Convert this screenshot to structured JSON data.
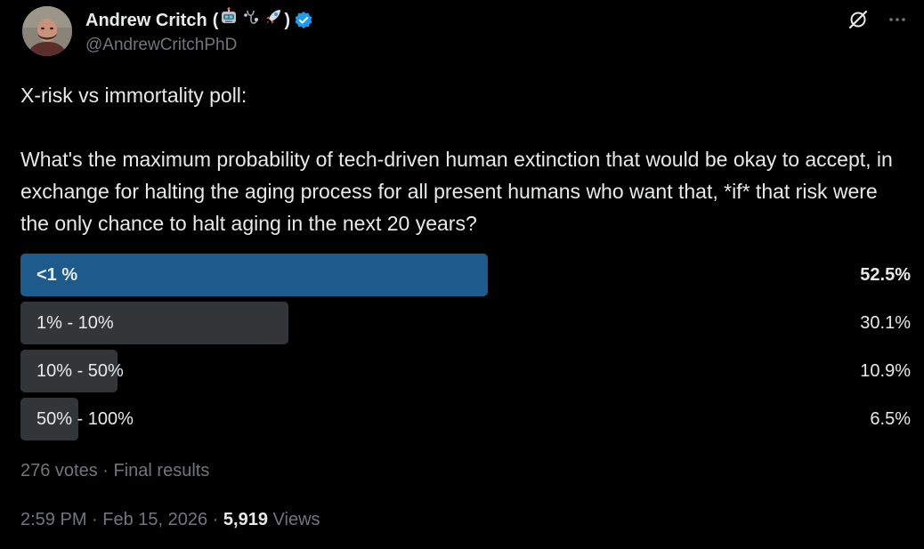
{
  "author": {
    "display_name": "Andrew Critch",
    "name_open": "(",
    "name_close": ")",
    "name_emojis": [
      "robot-face",
      "stethoscope",
      "rocket"
    ],
    "verified": true,
    "handle": "@AndrewCritchPhD"
  },
  "actions": {
    "grok_icon": "grok-icon",
    "more_icon": "more-icon"
  },
  "tweet": {
    "line1": "X-risk vs immortality poll:",
    "line2": "What's the maximum probability of tech-driven human extinction that would be okay to accept, in exchange for halting the aging process for all present humans who want that, *if* that risk were the only chance to halt aging in the next 20 years?"
  },
  "poll": {
    "options": [
      {
        "label": "<1 %",
        "percent": "52.5%",
        "value": 52.5,
        "winner": true
      },
      {
        "label": "1% - 10%",
        "percent": "30.1%",
        "value": 30.1,
        "winner": false
      },
      {
        "label": "10% - 50%",
        "percent": "10.9%",
        "value": 10.9,
        "winner": false
      },
      {
        "label": "50% - 100%",
        "percent": "6.5%",
        "value": 6.5,
        "winner": false
      }
    ],
    "votes": "276 votes",
    "separator": " · ",
    "status": "Final results"
  },
  "meta": {
    "time": "2:59 PM",
    "separator": " · ",
    "date": "Feb 15, 2026",
    "views_count": "5,919",
    "views_label": " Views"
  },
  "colors": {
    "winner_bar": "#1d5b8c",
    "other_bar": "#333639",
    "verified_badge": "#1d9bf0",
    "muted_text": "#71767b"
  }
}
